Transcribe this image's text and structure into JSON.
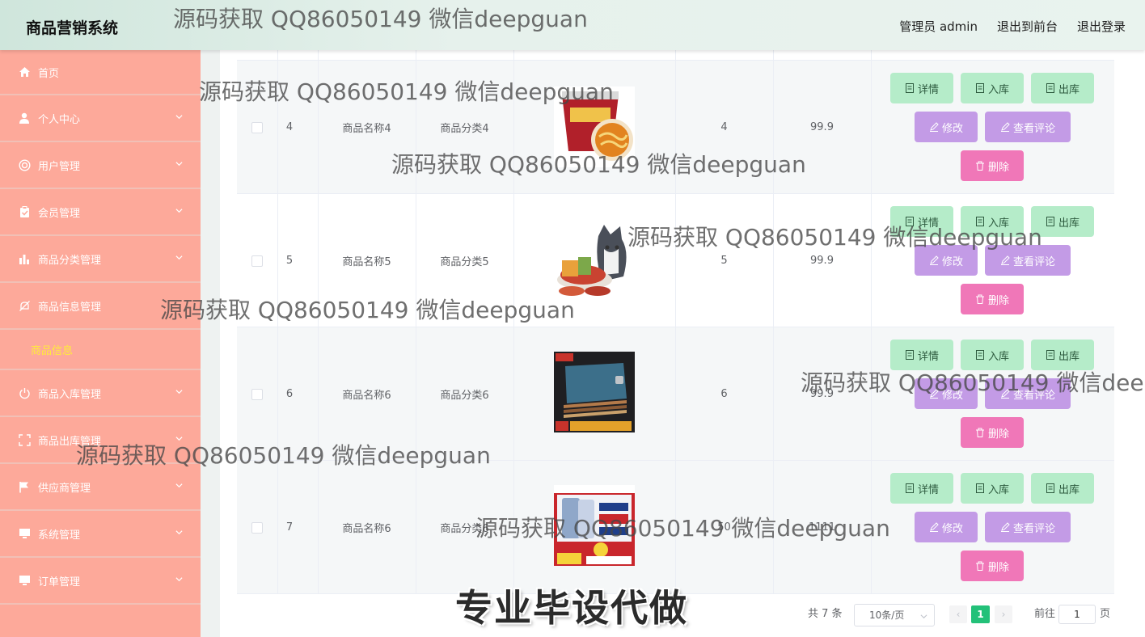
{
  "app": {
    "title": "商品营销系统",
    "nav": {
      "user_label": "管理员 admin",
      "front": "退出到前台",
      "logout": "退出登录"
    }
  },
  "sidebar": {
    "items": [
      {
        "label": "首页",
        "icon": "home-icon"
      },
      {
        "label": "个人中心",
        "icon": "person-icon"
      },
      {
        "label": "用户管理",
        "icon": "users-icon"
      },
      {
        "label": "会员管理",
        "icon": "clipboard-icon"
      },
      {
        "label": "商品分类管理",
        "icon": "bar-chart-icon"
      },
      {
        "label": "商品信息管理",
        "icon": "bell-off-icon"
      },
      {
        "label": "商品入库管理",
        "icon": "power-icon"
      },
      {
        "label": "商品出库管理",
        "icon": "fullscreen-icon"
      },
      {
        "label": "供应商管理",
        "icon": "flag-icon"
      },
      {
        "label": "系统管理",
        "icon": "monitor-icon"
      },
      {
        "label": "订单管理",
        "icon": "monitor-icon"
      }
    ],
    "active_sub": "商品信息"
  },
  "table": {
    "rows": [
      {
        "index": "4",
        "name": "商品名称4",
        "category": "商品分类4",
        "stock": "4",
        "price": "99.9",
        "image": "noodle-bowl"
      },
      {
        "index": "5",
        "name": "商品名称5",
        "category": "商品分类5",
        "stock": "5",
        "price": "99.9",
        "image": "snack-pack"
      },
      {
        "index": "6",
        "name": "商品名称6",
        "category": "商品分类6",
        "stock": "6",
        "price": "99.9",
        "image": "notebook-stack"
      },
      {
        "index": "7",
        "name": "商品名称6",
        "category": "商品分类6",
        "stock": "50",
        "price": "1111",
        "image": "phone-ad"
      }
    ],
    "buttons": {
      "detail": "详情",
      "in": "入库",
      "out": "出库",
      "edit": "修改",
      "comments": "查看评论",
      "delete": "删除"
    }
  },
  "pagination": {
    "total": "共 7 条",
    "page_size": "10条/页",
    "current": "1",
    "goto_prefix": "前往",
    "goto_value": "1",
    "goto_suffix": "页"
  },
  "overlay": {
    "watermark": "源码获取 QQ86050149 微信deepguan",
    "promo": "专业毕设代做"
  },
  "colors": {
    "sidebar": "#fda99a",
    "active_sub": "#ffeb3b",
    "green_button": "#b5ecc9",
    "purple_button": "#c39be6",
    "pink_button": "#f077b8",
    "pager_active": "#23c179"
  }
}
